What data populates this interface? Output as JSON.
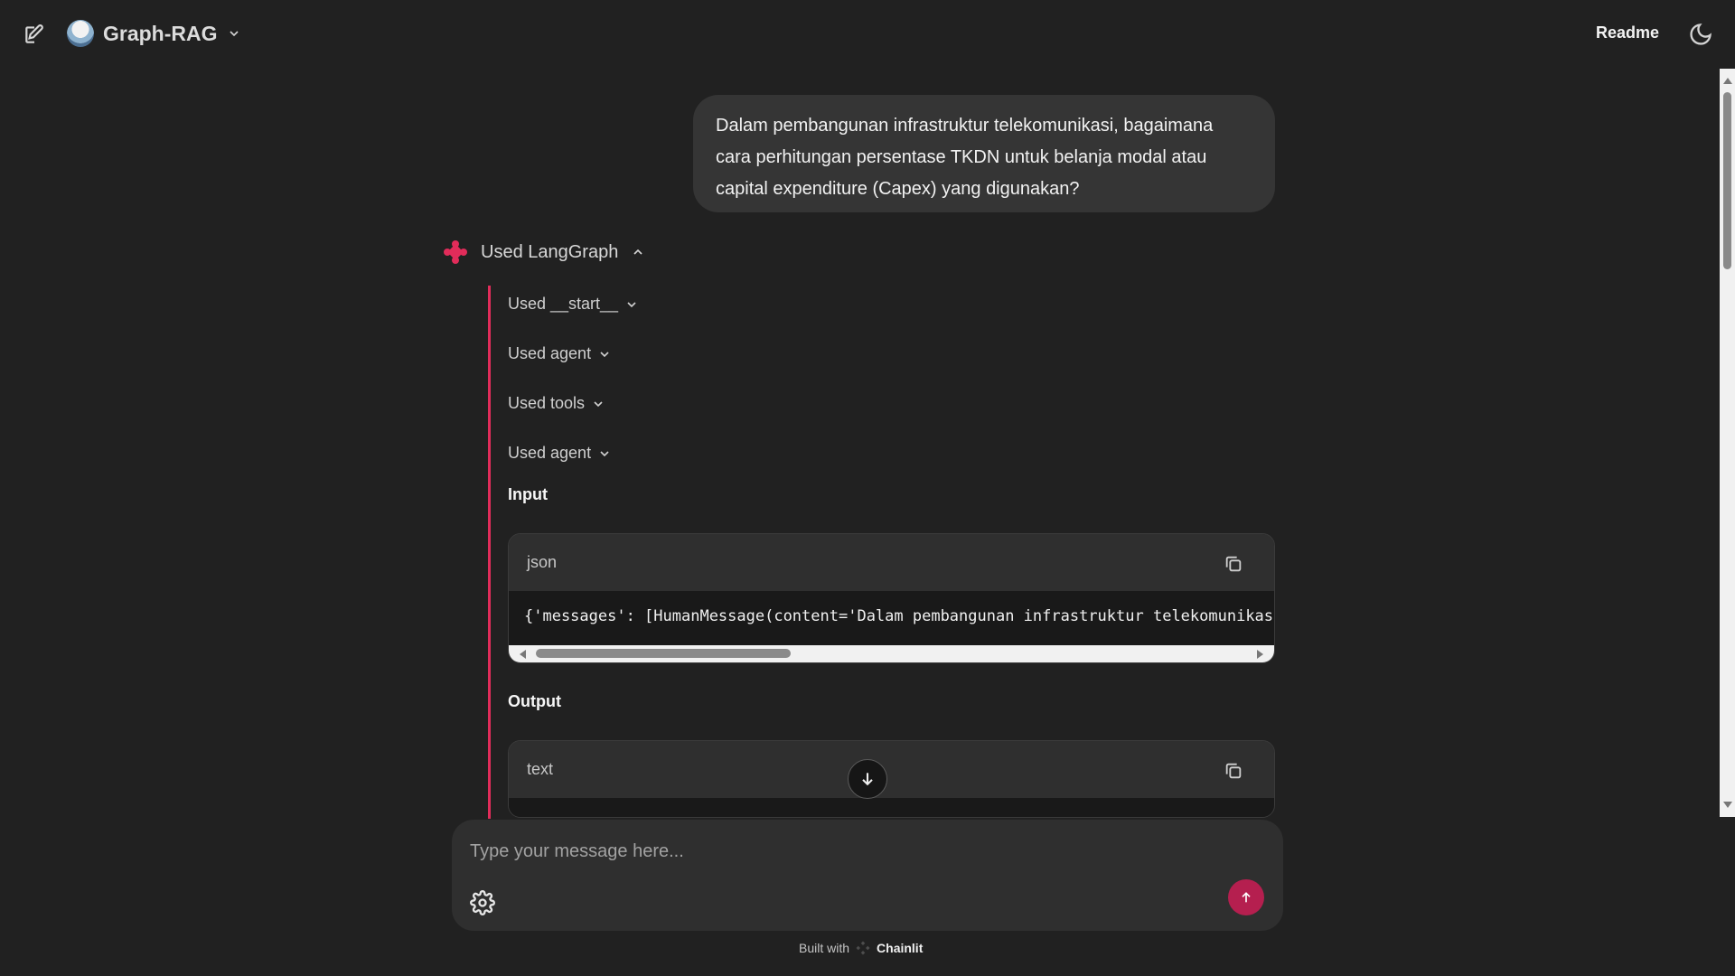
{
  "header": {
    "app_name": "Graph-RAG",
    "readme": "Readme",
    "icons": {
      "new_chat": "edit-icon",
      "dropdown": "chevron-down-icon",
      "theme": "moon-icon"
    }
  },
  "chat": {
    "user_message": "Dalam pembangunan infrastruktur telekomunikasi, bagaimana cara perhitungan persentase TKDN untuk belanja modal atau capital expenditure (Capex) yang digunakan?",
    "langgraph_label": "Used LangGraph",
    "steps": [
      "Used __start__",
      "Used agent",
      "Used tools",
      "Used agent"
    ],
    "input_label": "Input",
    "output_label": "Output",
    "input_language": "json",
    "input_code": "{'messages': [HumanMessage(content='Dalam pembangunan infrastruktur telekomunikasi, ba",
    "output_language": "text"
  },
  "composer": {
    "placeholder": "Type your message here..."
  },
  "footer": {
    "built_with": "Built with",
    "brand": "Chainlit"
  },
  "colors": {
    "background": "#212121",
    "accent": "#e12c5a",
    "send_button": "#b51f4f",
    "surface": "#2f2f2f"
  }
}
